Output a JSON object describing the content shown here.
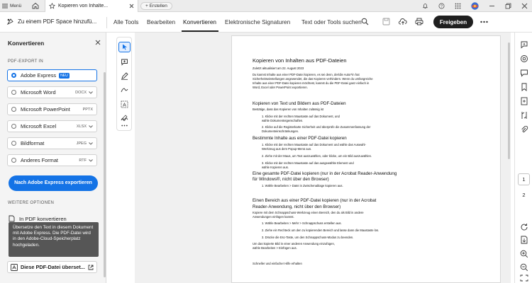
{
  "titlebar": {
    "menu_label": "Menü",
    "tab_title": "Kopieren von Inhalte...",
    "new_tab_label": "+ Erstellen"
  },
  "toolbar": {
    "pdf_space_label": "Zu einem PDF Space hinzufü...",
    "tabs": [
      "Alle Tools",
      "Bearbeiten",
      "Konvertieren",
      "Elektronische Signaturen"
    ],
    "active_tab": "Konvertieren",
    "search_label": "Text oder Tools suchen",
    "share_label": "Freigeben"
  },
  "panel": {
    "title": "Konvertieren",
    "export_header": "PDF-EXPORT IN",
    "formats": [
      {
        "label": "Adobe Express",
        "ext": "",
        "badge": "NEU",
        "selected": true
      },
      {
        "label": "Microsoft Word",
        "ext": "DOCX"
      },
      {
        "label": "Microsoft PowerPoint",
        "ext": "PPTX"
      },
      {
        "label": "Microsoft Excel",
        "ext": "XLSX"
      },
      {
        "label": "Bildformat",
        "ext": "JPEG"
      },
      {
        "label": "Anderes Format",
        "ext": "RTF"
      }
    ],
    "export_button": "Nach Adobe Express exportieren",
    "more_header": "WEITERE OPTIONEN",
    "in_pdf_label": "In PDF konvertieren",
    "tooltip": "Übersetze den Text in diesem Dokument mit Adobe Express. Die PDF-Datei wird in den Adobe-Cloud-Speicherplatz hochgeladen.",
    "translate_label": "Diese PDF-Datei überset..."
  },
  "document": {
    "title": "Kopieren von Inhalten aus PDF-Dateien",
    "updated": "Zuletzt aktualisiert am 22. August 2023",
    "intro": [
      "Du kannst Inhalte aus einer PDF-Datei kopieren, es sei denn, der/die Autor*in hat",
      "Sicherheitseinstellungen angewendet, die das Kopieren verhindern. Wenn du umfangreiche",
      "Inhalte aus einer PDF-Datei kopieren möchtest, kannst du die PDF-Datei ganz einfach in",
      "Word, Excel oder PowerPoint exportieren."
    ],
    "s1_heading": "Kopieren von Text und Bildern aus PDF-Dateien",
    "s1_sub": "Bestätige, dass das Kopieren von Inhalten zulässig ist",
    "s1_items": [
      "1.  Klicke mit der rechten Maustaste auf das Dokument, und",
      "     wähle Dokumenteigenschaften.",
      "2.  Klicke auf die Registerkarte Sicherheit und überprüfe die Zusammenfassung der",
      "     Dokumenteinschränkungen."
    ],
    "s2_heading": "Bestimmte Inhalte aus einer PDF-Datei kopieren",
    "s2_items": [
      "1.  Klicke mit der rechten Maustaste auf das Dokument und wähle das Auswahl-",
      "     Werkzeug aus dem Popup-Menü aus.",
      "2.  Ziehe mit der Maus, um Text auszuwählen, oder klicke, um ein Bild auszuwählen.",
      "3.  Klicke mit der rechten Maustaste auf das ausgewählte Element und",
      "     wähle Kopieren aus."
    ],
    "s3_heading_1": "Eine gesamte PDF-Datei kopieren (nur in der Acrobat Reader-Anwendung",
    "s3_heading_2": "für Windows®, nicht über den Browser)",
    "s3_items": [
      "1.  Wähle Bearbeiten > Datei in Zwischenablage kopieren aus."
    ],
    "s4_heading_1": "Einen Bereich aus einer PDF-Datei kopieren (nur in der Acrobat",
    "s4_heading_2": "Reader-Anwendung, nicht über den Browser)",
    "s4_intro": [
      "Kopiere mit dem Schnappschuss-Werkzeug einen Bereich, den du als Bild in andere",
      "Anwendungen einfügen kannst."
    ],
    "s4_items": [
      "1.  Wähle Bearbeiten > Mehr > Schnappschuss erstellen aus.",
      "2.  Ziehe ein Rechteck um den zu kopierenden Bereich und lasse dann die Maustaste los.",
      "3.  Drücke die Esc-Taste, um den Schnappschuss-Modus zu beenden."
    ],
    "s4_outro": [
      "Um das kopierte Bild in einer anderen Anwendung einzufügen,",
      "wähle Bearbeiten > Einfügen aus."
    ],
    "footer": "Schneller und einfacher Hilfe erhalten"
  },
  "pages": {
    "current": "1",
    "total": "2"
  },
  "colors": {
    "accent": "#1473e6",
    "share": "#1f1f1f",
    "tooltip": "#565656"
  }
}
